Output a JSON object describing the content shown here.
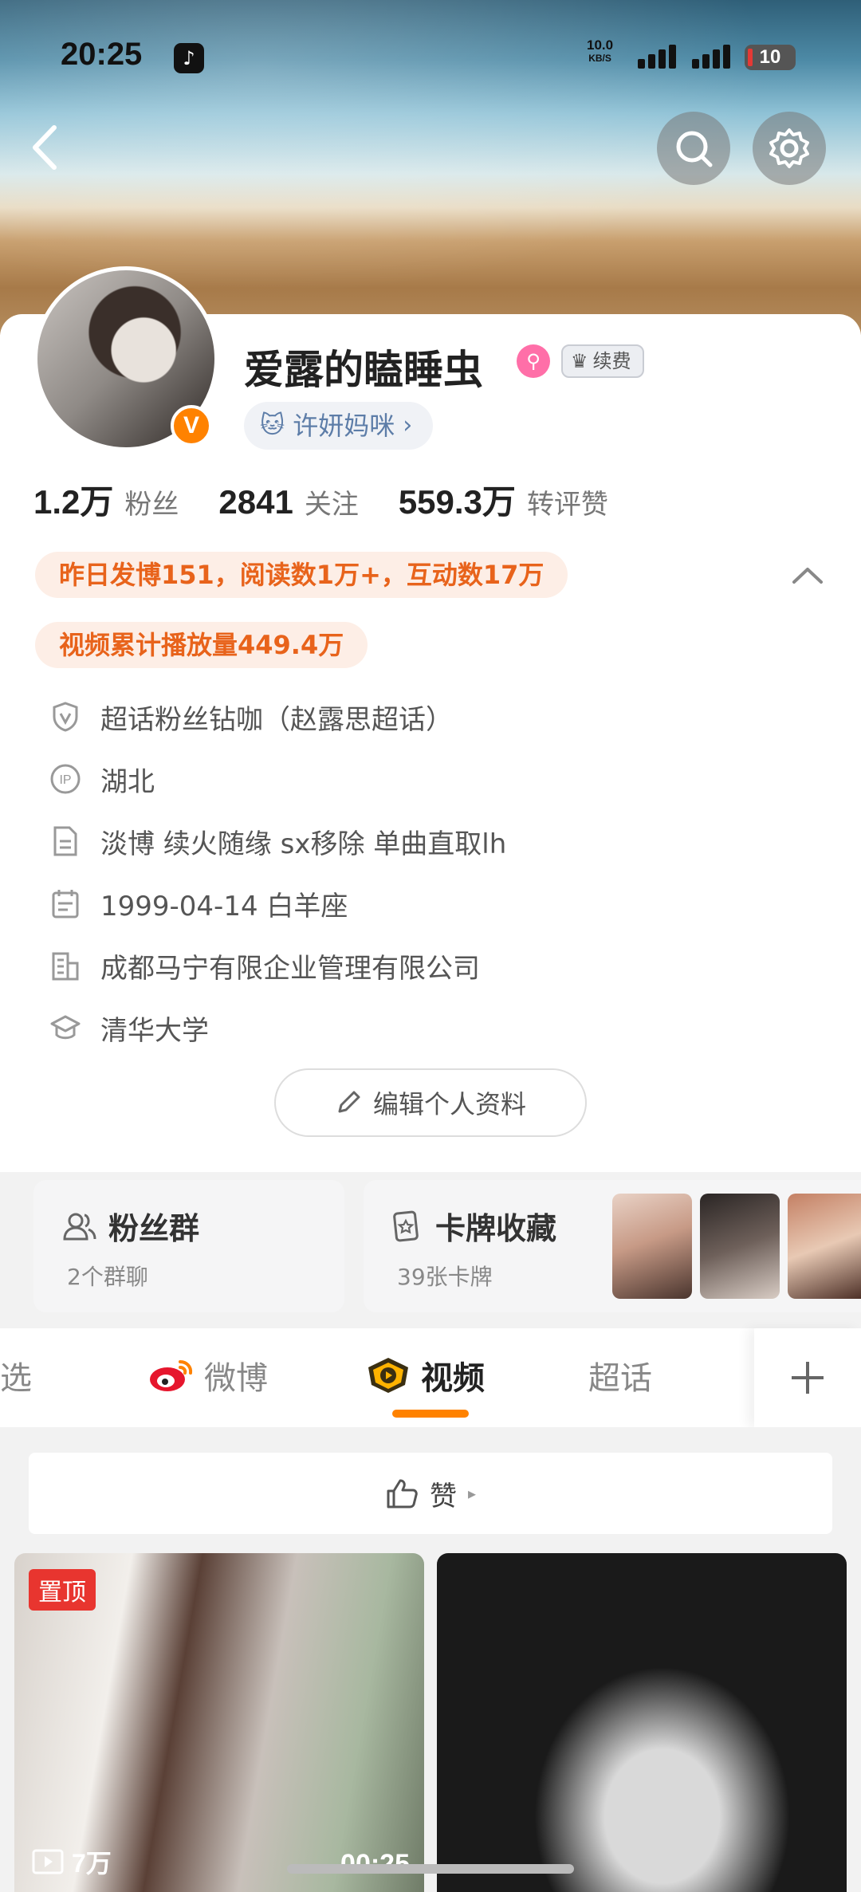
{
  "status_bar": {
    "time": "20:25",
    "net_speed_value": "10.0",
    "net_speed_unit": "KB/S",
    "battery": "10"
  },
  "profile": {
    "username": "爱露的瞌睡虫",
    "renew_label": "续费",
    "fan_title": "许妍妈咪",
    "stats": [
      {
        "num": "1.2万",
        "label": "粉丝"
      },
      {
        "num": "2841",
        "label": "关注"
      },
      {
        "num": "559.3万",
        "label": "转评赞"
      }
    ],
    "activity_pill": "昨日发博151，阅读数1万+，互动数17万",
    "video_pill": "视频累计播放量449.4万",
    "info": {
      "superfan": "超话粉丝钻咖（赵露思超话）",
      "ip": "湖北",
      "bio": "淡博 续火随缘 sx移除 单曲直取lh",
      "birthday": "1999-04-14 白羊座",
      "company": "成都马宁有限企业管理有限公司",
      "school": "清华大学"
    },
    "edit_button": "编辑个人资料"
  },
  "cards": {
    "fan_group_title": "粉丝群",
    "fan_group_sub": "2个群聊",
    "card_title": "卡牌收藏",
    "card_sub": "39张卡牌"
  },
  "tabs": {
    "partial": "选",
    "weibo": "微博",
    "video": "视频",
    "supertopic": "超话",
    "active": "video"
  },
  "feed": {
    "like_label": "赞",
    "video1": {
      "pin": "置顶",
      "views": "7万",
      "duration": "00:25"
    }
  },
  "colors": {
    "accent": "#ff8200",
    "pill_text": "#e8631b",
    "pill_bg": "#fdeee6",
    "pin": "#e8352f"
  }
}
